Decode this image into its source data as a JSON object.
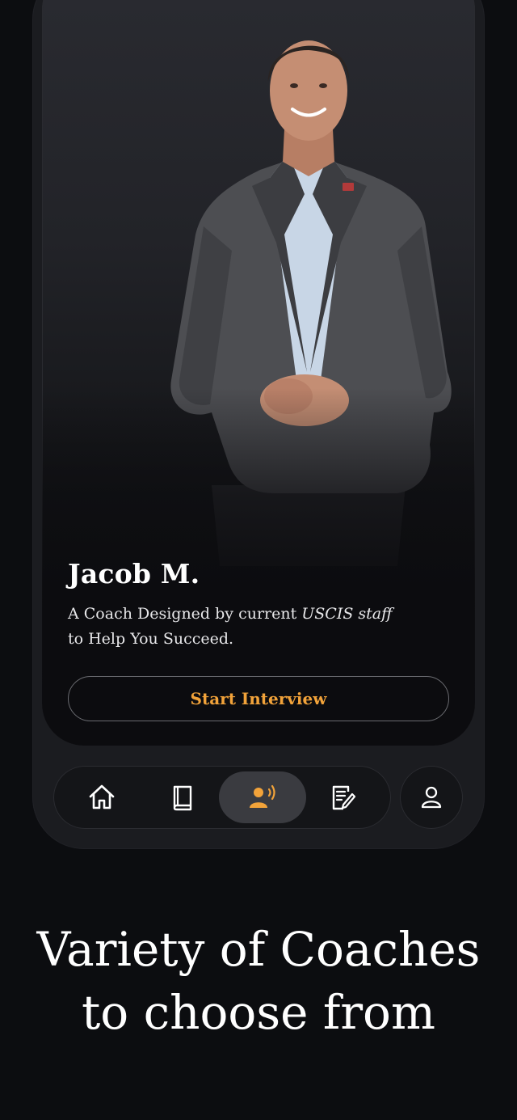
{
  "coach": {
    "name": "Jacob M.",
    "desc_prefix": "A Coach Designed by current ",
    "desc_emph": "USCIS staff",
    "desc_line2": "to Help You Succeed.",
    "start_label": "Start Interview"
  },
  "tabs": [
    {
      "icon": "home-icon",
      "active": false
    },
    {
      "icon": "book-icon",
      "active": false
    },
    {
      "icon": "coach-voice-icon",
      "active": true
    },
    {
      "icon": "notes-edit-icon",
      "active": false
    }
  ],
  "profile": {
    "icon": "user-icon"
  },
  "headline": {
    "line1": "Variety of Coaches",
    "line2": "to choose from"
  },
  "colors": {
    "accent": "#f2a33a",
    "background": "#0c0d10",
    "card": "#1b1c20",
    "tab_active": "#3a3b40"
  }
}
